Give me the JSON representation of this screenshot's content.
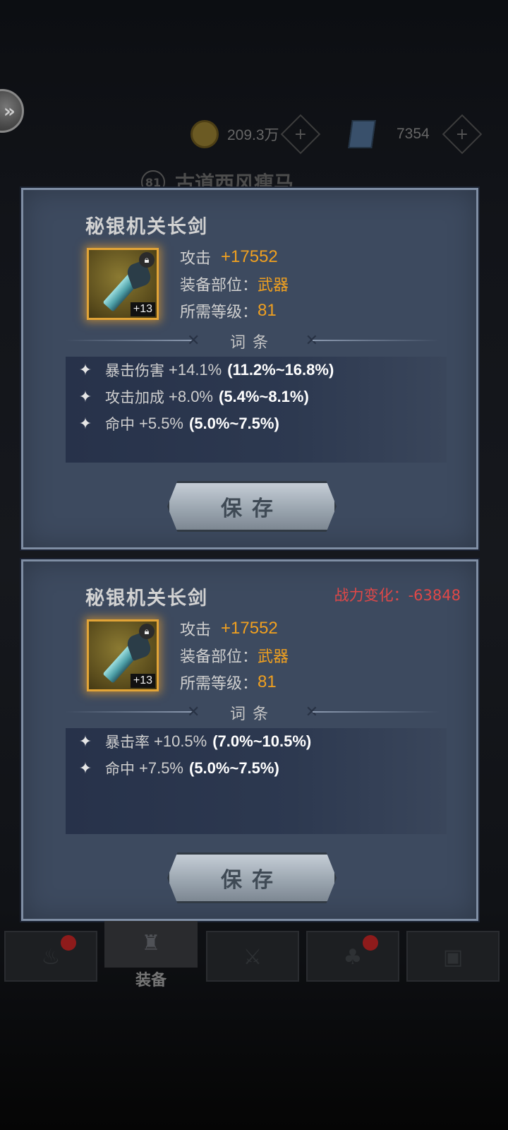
{
  "resources": {
    "gold": "209.3万",
    "books": "7354",
    "plus": "+"
  },
  "stage": {
    "badge": "81",
    "name": "古道西风瘦马"
  },
  "panels": [
    {
      "item_name": "秘银机关长剑",
      "power_change": "",
      "level_badge": "+13",
      "stats": [
        {
          "label": "攻击",
          "value": "+17552"
        },
        {
          "label": "装备部位：",
          "value": "武器"
        },
        {
          "label": "所需等级：",
          "value": "81"
        }
      ],
      "affix_title": "词条",
      "affixes": [
        {
          "name": "暴击伤害",
          "value": "+14.1%",
          "range": "(11.2%~16.8%)"
        },
        {
          "name": "攻击加成",
          "value": "+8.0%",
          "range": "(5.4%~8.1%)"
        },
        {
          "name": "命中",
          "value": "+5.5%",
          "range": "(5.0%~7.5%)"
        }
      ],
      "save_label": "保存"
    },
    {
      "item_name": "秘银机关长剑",
      "power_change": "战力变化：-63848",
      "level_badge": "+13",
      "stats": [
        {
          "label": "攻击",
          "value": "+17552"
        },
        {
          "label": "装备部位：",
          "value": "武器"
        },
        {
          "label": "所需等级：",
          "value": "81"
        }
      ],
      "affix_title": "词条",
      "affixes": [
        {
          "name": "暴击率",
          "value": "+10.5%",
          "range": "(7.0%~10.5%)"
        },
        {
          "name": "命中",
          "value": "+7.5%",
          "range": "(5.0%~7.5%)"
        }
      ],
      "save_label": "保存"
    }
  ],
  "nav": {
    "active_label": "装备",
    "items": [
      {
        "icon": "campfire-icon",
        "glyph": "♨",
        "badge": true
      },
      {
        "icon": "crossed-swords-icon",
        "glyph": "⚔",
        "badge": false
      },
      {
        "icon": "tree-icon",
        "glyph": "♣",
        "badge": true
      },
      {
        "icon": "chest-icon",
        "glyph": "▣",
        "badge": false
      }
    ]
  },
  "colors": {
    "panel_bg": "#3d4a5f",
    "accent_orange": "#f0a020",
    "power_red": "#e04848"
  }
}
